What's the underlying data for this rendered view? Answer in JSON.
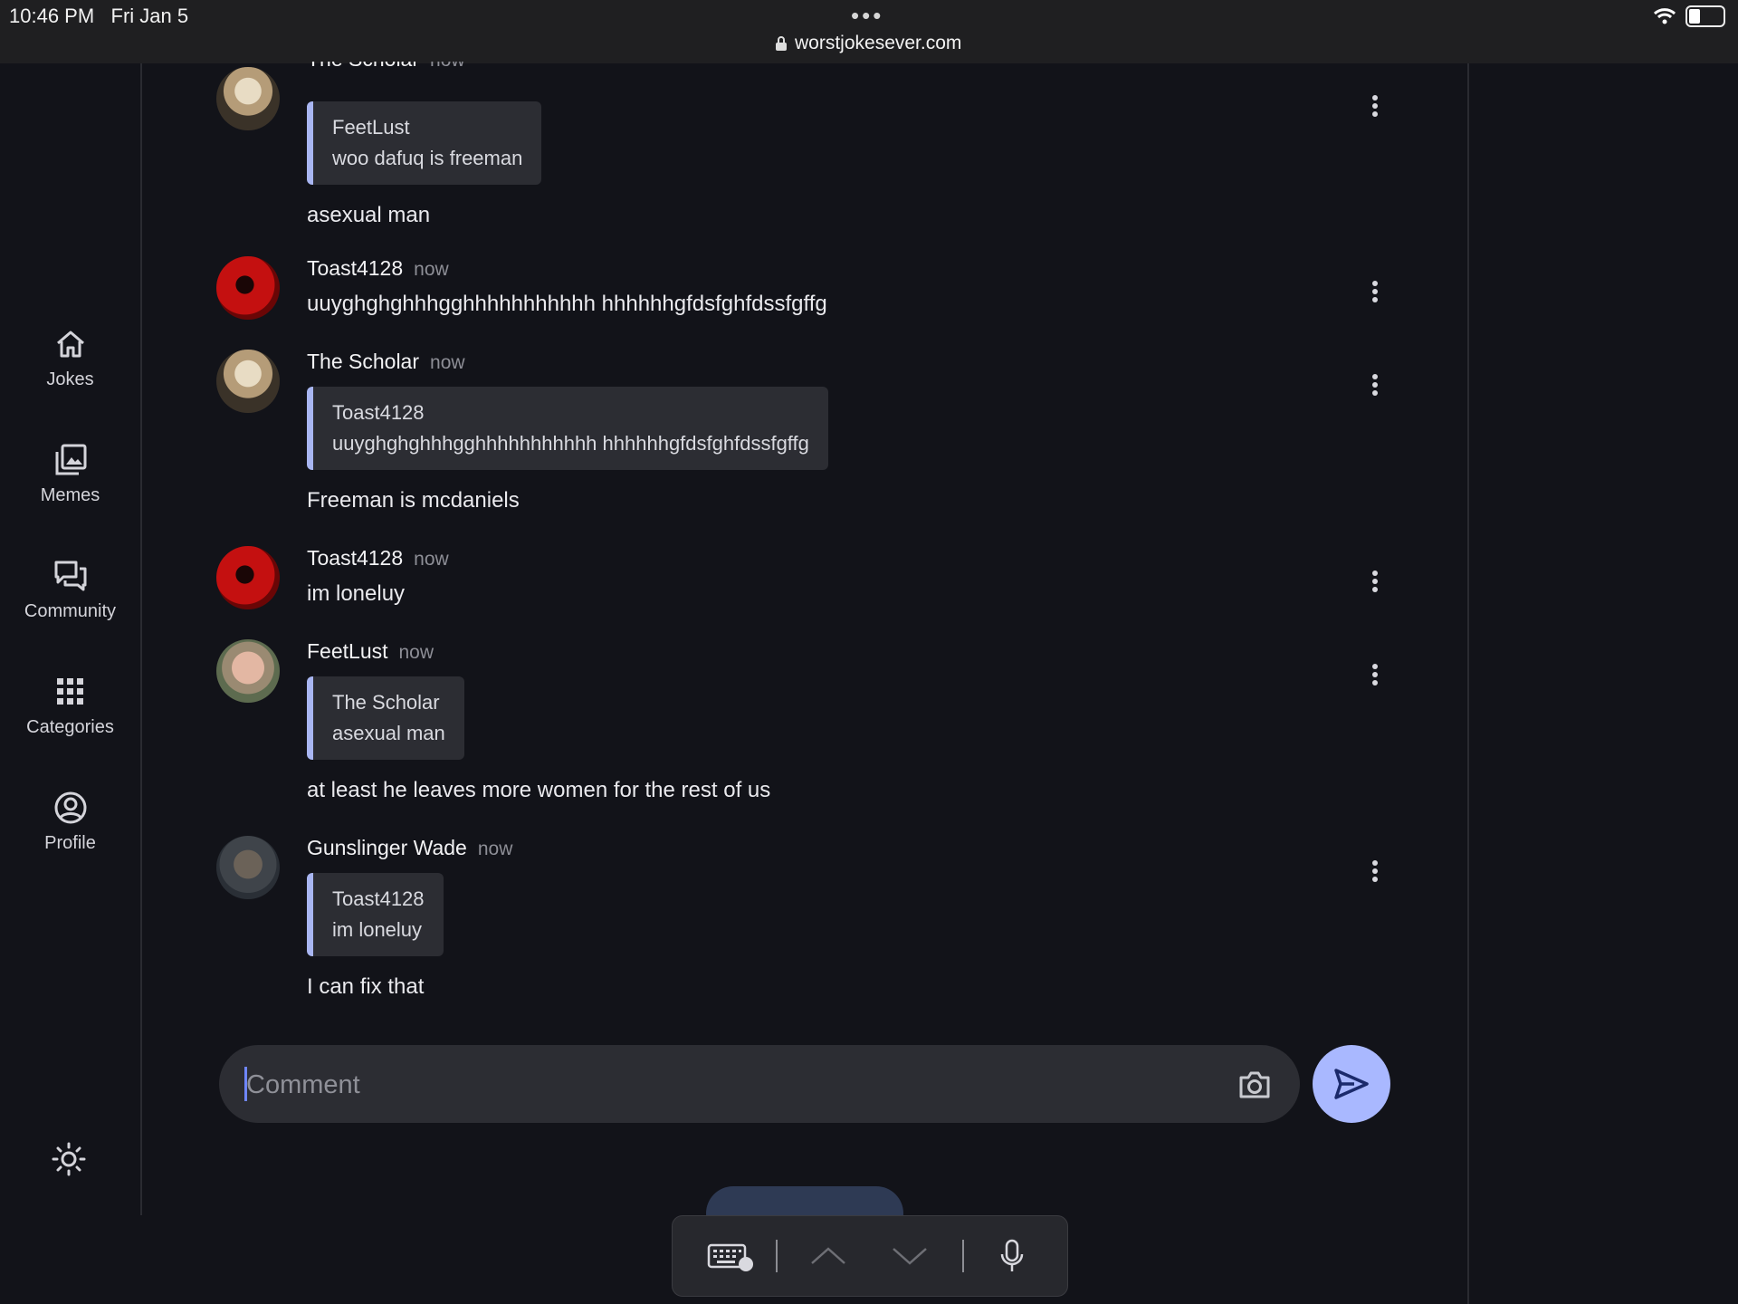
{
  "status_bar": {
    "time": "10:46 PM",
    "date": "Fri Jan 5",
    "url": "worstjokesever.com",
    "wifi_icon": "wifi-icon",
    "battery_icon": "battery-icon"
  },
  "sidebar": {
    "items": [
      {
        "label": "Jokes",
        "icon": "home-icon"
      },
      {
        "label": "Memes",
        "icon": "image-gallery-icon"
      },
      {
        "label": "Community",
        "icon": "chat-bubbles-icon"
      },
      {
        "label": "Categories",
        "icon": "grid-icon"
      },
      {
        "label": "Profile",
        "icon": "user-circle-icon"
      }
    ],
    "theme_toggle_icon": "sun-icon"
  },
  "messages": [
    {
      "author": "The Scholar",
      "time": "now",
      "quote": {
        "author": "FeetLust",
        "text": "woo dafuq is freeman"
      },
      "text": "asexual man"
    },
    {
      "author": "Toast4128",
      "time": "now",
      "text": "uuyghghghhhgghhhhhhhhhhh hhhhhhgfdsfghfdssfgffg"
    },
    {
      "author": "The Scholar",
      "time": "now",
      "quote": {
        "author": "Toast4128",
        "text": "uuyghghghhhgghhhhhhhhhhh hhhhhhgfdsfghfdssfgffg"
      },
      "text": "Freeman is mcdaniels"
    },
    {
      "author": "Toast4128",
      "time": "now",
      "text": "im loneluy"
    },
    {
      "author": "FeetLust",
      "time": "now",
      "quote": {
        "author": "The Scholar",
        "text": "asexual man"
      },
      "text": "at least he leaves more women for the rest of us"
    },
    {
      "author": "Gunslinger Wade",
      "time": "now",
      "quote": {
        "author": "Toast4128",
        "text": "im loneluy"
      },
      "text": "I can fix that"
    }
  ],
  "comment": {
    "placeholder": "Comment",
    "value": "",
    "camera_icon": "camera-icon",
    "send_icon": "send-icon"
  },
  "colors": {
    "background": "#121319",
    "accent": "#a9b8ff",
    "quote_bar": "#a9b6f2"
  }
}
